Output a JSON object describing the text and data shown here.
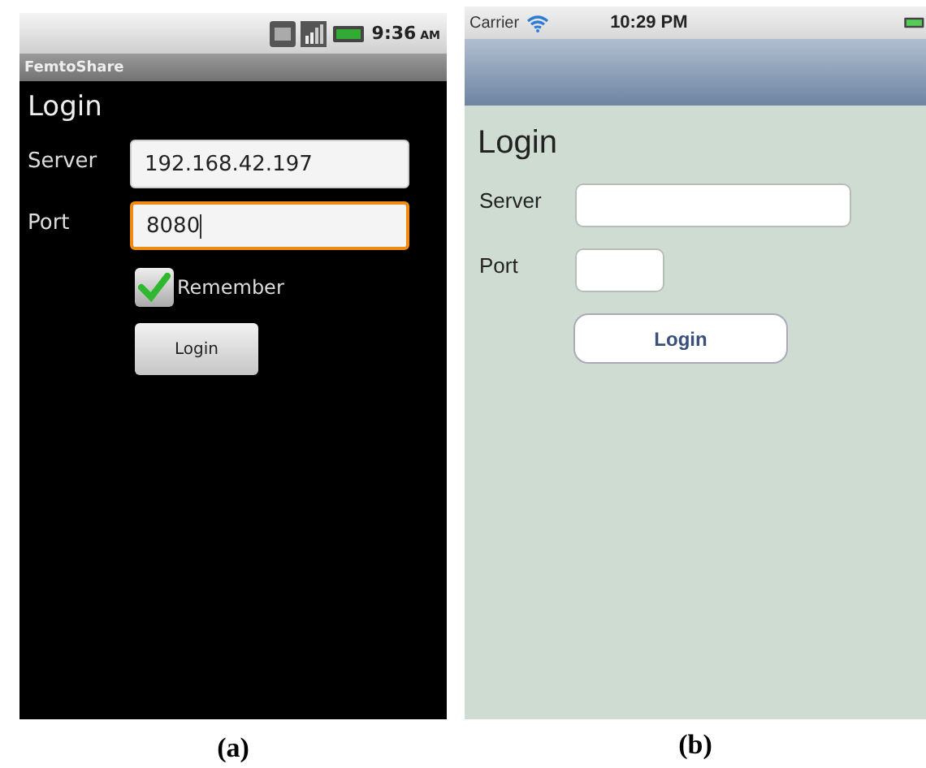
{
  "android": {
    "status_bar": {
      "time": "9:36",
      "ampm": "AM"
    },
    "app_title": "FemtoShare",
    "heading": "Login",
    "fields": [
      {
        "label": "Server",
        "value": "192.168.42.197",
        "focused": false
      },
      {
        "label": "Port",
        "value": "8080",
        "focused": true
      }
    ],
    "checkbox": {
      "label": "Remember",
      "checked": true
    },
    "button": "Login",
    "caption": "(a)"
  },
  "ios": {
    "status_bar": {
      "carrier": "Carrier",
      "time": "10:29 PM"
    },
    "heading": "Login",
    "fields": [
      {
        "label": "Server"
      },
      {
        "label": "Port"
      }
    ],
    "button": "Login",
    "caption": "(b)"
  }
}
